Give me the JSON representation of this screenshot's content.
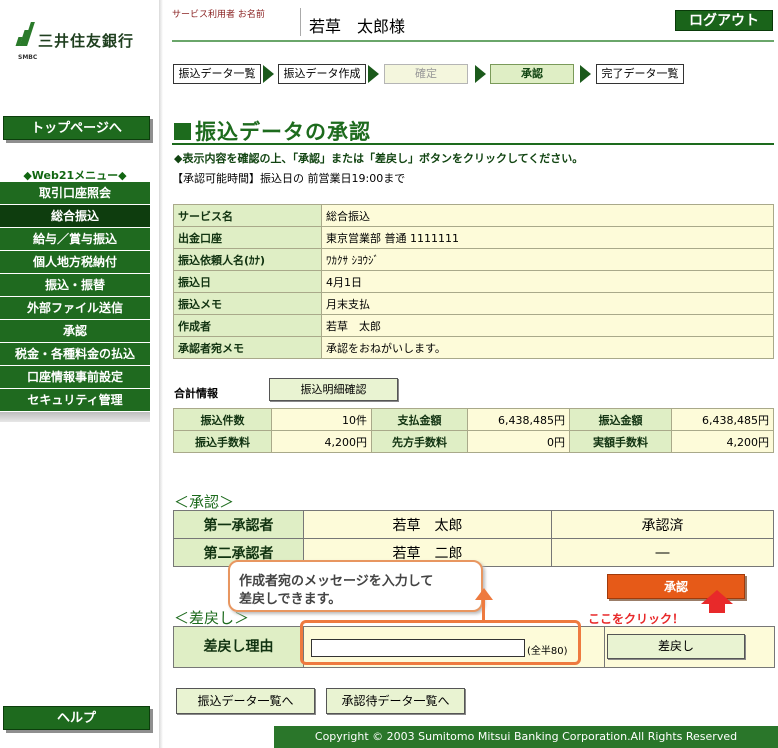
{
  "brand": {
    "name": "三井住友銀行",
    "abbr": "SMBC"
  },
  "sidebar": {
    "top_button": "トップページへ",
    "menu_title": "◆Web21メニュー◆",
    "items": [
      {
        "label": "取引口座照会"
      },
      {
        "label": "総合振込",
        "active": true
      },
      {
        "label": "給与／賞与振込"
      },
      {
        "label": "個人地方税納付"
      },
      {
        "label": "振込・振替"
      },
      {
        "label": "外部ファイル送信"
      },
      {
        "label": "承認"
      },
      {
        "label": "税金・各種料金の払込"
      },
      {
        "label": "口座情報事前設定"
      },
      {
        "label": "セキュリティ管理"
      }
    ],
    "help_button": "ヘルプ"
  },
  "header": {
    "user_label": "サービス利用者 お名前",
    "user_name": "若草　太郎様",
    "logout": "ログアウト"
  },
  "steps": [
    {
      "label": "振込データ一覧"
    },
    {
      "label": "振込データ作成"
    },
    {
      "label": "確定",
      "state": "dim"
    },
    {
      "label": "承認",
      "state": "current"
    },
    {
      "label": "完了データ一覧"
    }
  ],
  "page": {
    "title": "振込データの承認",
    "instruction": "◆表示内容を確認の上、「承認」または「差戻し」ボタンをクリックしてください。",
    "hours": "【承認可能時間】振込日の 前営業日19:00まで"
  },
  "details": [
    {
      "key": "サービス名",
      "value": "総合振込"
    },
    {
      "key": "出金口座",
      "value": "東京営業部 普通 1111111"
    },
    {
      "key": "振込依頼人名(ｶﾅ)",
      "value": "ﾜｶｸｻ ｼﾖｳｼﾞ"
    },
    {
      "key": "振込日",
      "value": "4月1日"
    },
    {
      "key": "振込メモ",
      "value": "月末支払"
    },
    {
      "key": "作成者",
      "value": "若草　太郎"
    },
    {
      "key": "承認者宛メモ",
      "value": "承認をおねがいします。"
    }
  ],
  "summary": {
    "label": "合計情報",
    "detail_button": "振込明細確認",
    "rows": [
      [
        {
          "key": "振込件数",
          "value": "10件"
        },
        {
          "key": "支払金額",
          "value": "6,438,485円"
        },
        {
          "key": "振込金額",
          "value": "6,438,485円"
        }
      ],
      [
        {
          "key": "振込手数料",
          "value": "4,200円"
        },
        {
          "key": "先方手数料",
          "value": "0円"
        },
        {
          "key": "実額手数料",
          "value": "4,200円"
        }
      ]
    ]
  },
  "approval": {
    "section_title": "＜承認＞",
    "approvers": [
      {
        "role": "第一承認者",
        "name": "若草　太郎",
        "status": "承認済"
      },
      {
        "role": "第二承認者",
        "name": "若草　二郎",
        "status": "―"
      }
    ],
    "approve_button": "承認",
    "click_hint": "ここをクリック！"
  },
  "return_section": {
    "section_title": "＜差戻し＞",
    "reason_label": "差戻し理由",
    "reason_value": "",
    "reason_hint": "(全半80)",
    "return_button": "差戻し"
  },
  "callout": {
    "line1": "作成者宛のメッセージを入力して",
    "line2": "差戻しできます。"
  },
  "footer_buttons": {
    "list": "振込データ一覧へ",
    "pending": "承認待データ一覧へ"
  },
  "copyright": "Copyright © 2003 Sumitomo Mitsui Banking Corporation.All Rights Reserved",
  "colors": {
    "brand_green": "#1d6b1d",
    "key_cell": "#dfeec5",
    "value_cell": "#fdfbd9",
    "approve_orange": "#e65a18",
    "hint_red": "#e8292a"
  }
}
